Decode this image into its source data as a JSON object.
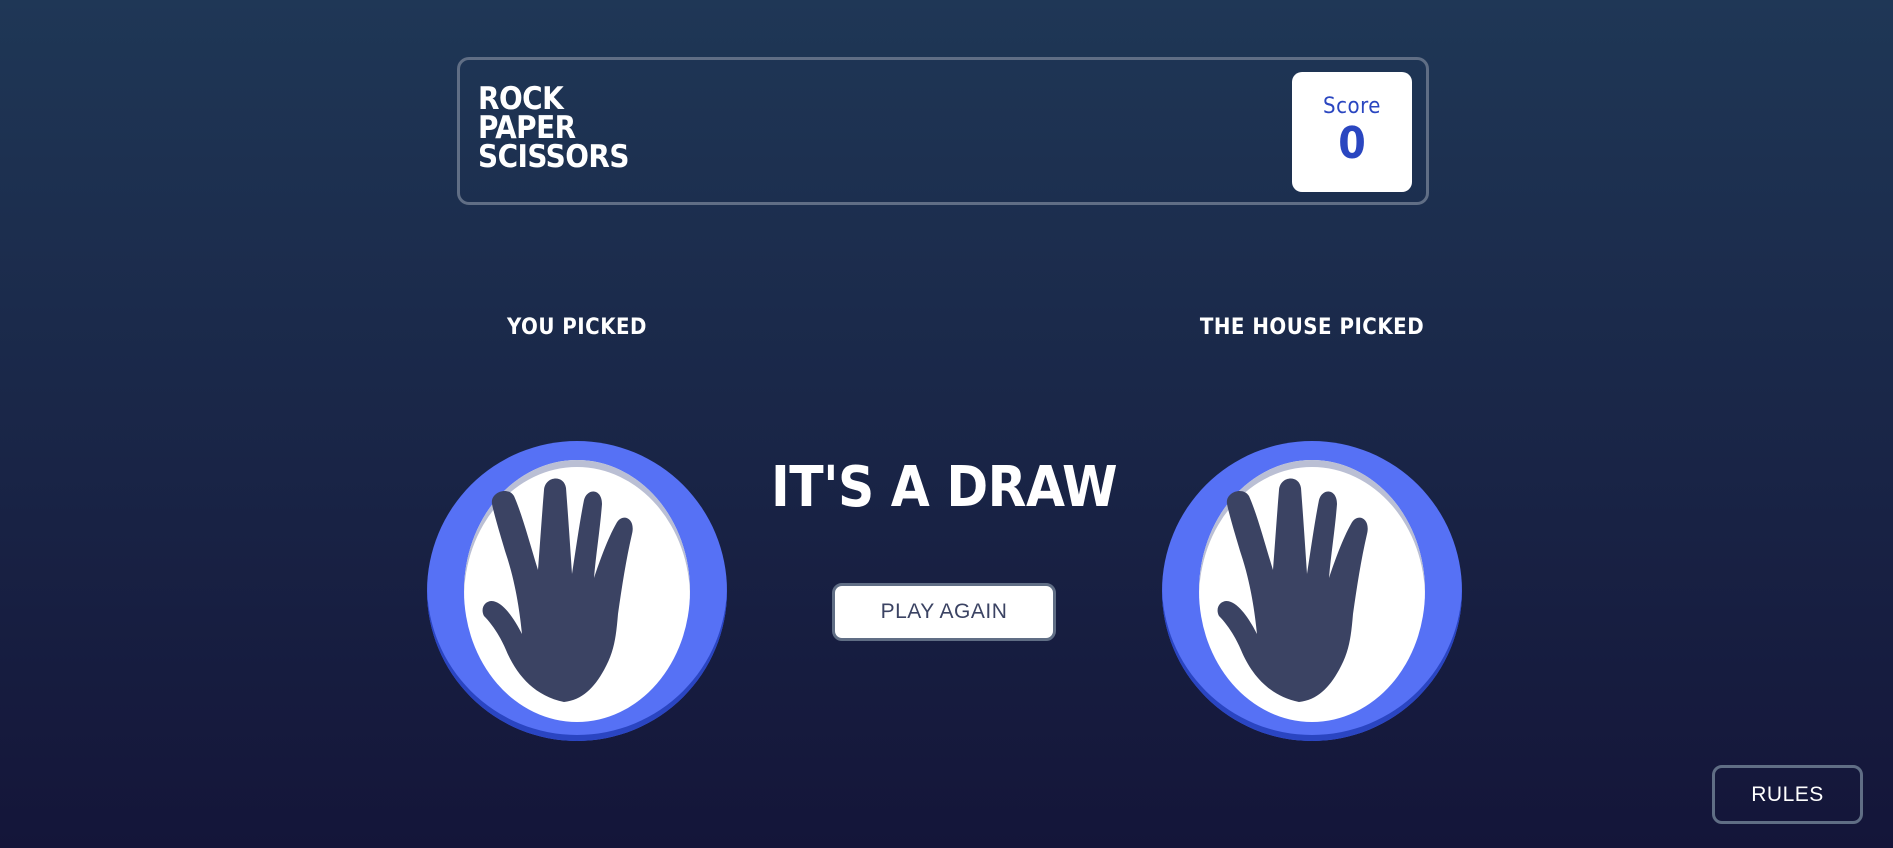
{
  "header": {
    "title_lines": [
      "ROCK",
      "PAPER",
      "SCISSORS"
    ],
    "score_label": "Score",
    "score_value": "0"
  },
  "game": {
    "you_label": "YOU PICKED",
    "house_label": "THE HOUSE PICKED",
    "you_pick_icon": "paper-hand-icon",
    "house_pick_icon": "paper-hand-icon",
    "result_text": "IT'S A DRAW",
    "play_again_label": "PLAY AGAIN"
  },
  "footer": {
    "rules_label": "RULES"
  },
  "colors": {
    "background_top": "#1f3756",
    "background_bottom": "#141539",
    "paper_ring": "#5671f5",
    "score_text": "#2a46c0",
    "hand": "#3b4363",
    "outline": "#606e85"
  }
}
